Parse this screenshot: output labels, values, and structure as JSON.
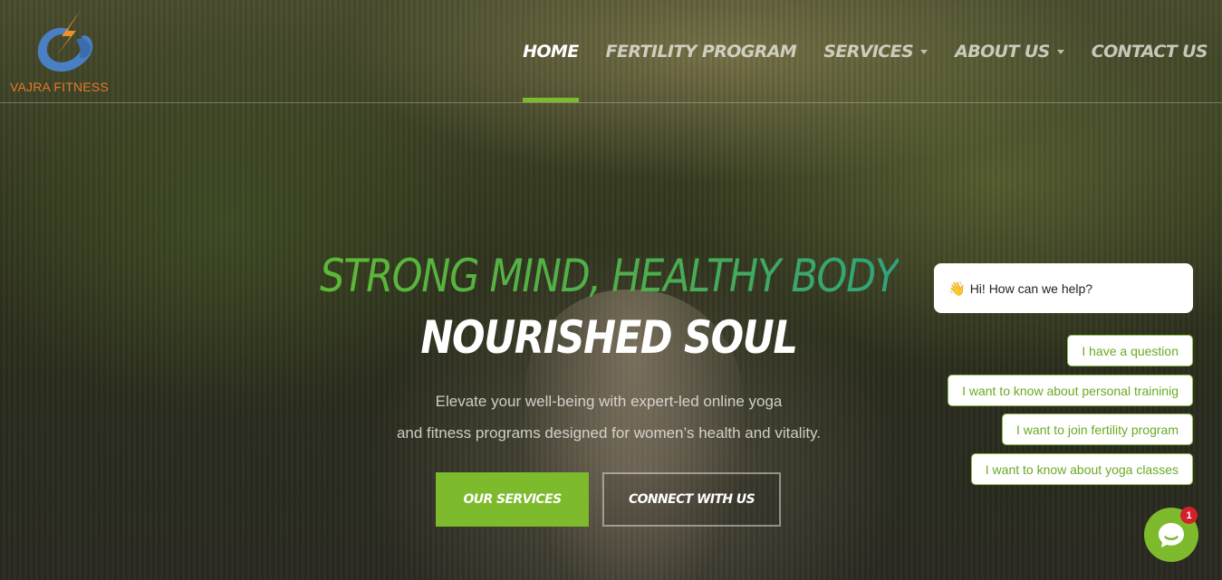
{
  "brand": {
    "name": "VAJRA FITNESS",
    "logo_icon": "lightning-swoosh-logo",
    "colors": {
      "orange": "#e07a2a",
      "blue": "#4a7fc4"
    }
  },
  "nav": {
    "items": [
      {
        "label": "HOME",
        "active": true,
        "dropdown": false
      },
      {
        "label": "FERTILITY PROGRAM",
        "active": false,
        "dropdown": false
      },
      {
        "label": "SERVICES",
        "active": false,
        "dropdown": true
      },
      {
        "label": "ABOUT US",
        "active": false,
        "dropdown": true
      },
      {
        "label": "CONTACT US",
        "active": false,
        "dropdown": false
      }
    ],
    "active_indicator_color": "#7dba2c"
  },
  "hero": {
    "headline": "STRONG MIND, HEALTHY BODY",
    "subheadline": "NOURISHED SOUL",
    "description_line1": "Elevate your well-being with expert-led online yoga",
    "description_line2": "and fitness programs designed for women’s health and vitality.",
    "primary_button": "OUR SERVICES",
    "secondary_button": "CONNECT WITH US",
    "accent_color": "#7dba2c"
  },
  "chat": {
    "greeting_icon": "waving-hand-icon",
    "greeting": "Hi! How can we help?",
    "options": [
      "I have a question",
      "I want to know about personal traininig",
      "I want to join fertility program",
      "I want to know about yoga classes"
    ],
    "launcher_icon": "chat-bubble-icon",
    "unread_count": "1",
    "accent_color": "#7dba2c"
  }
}
